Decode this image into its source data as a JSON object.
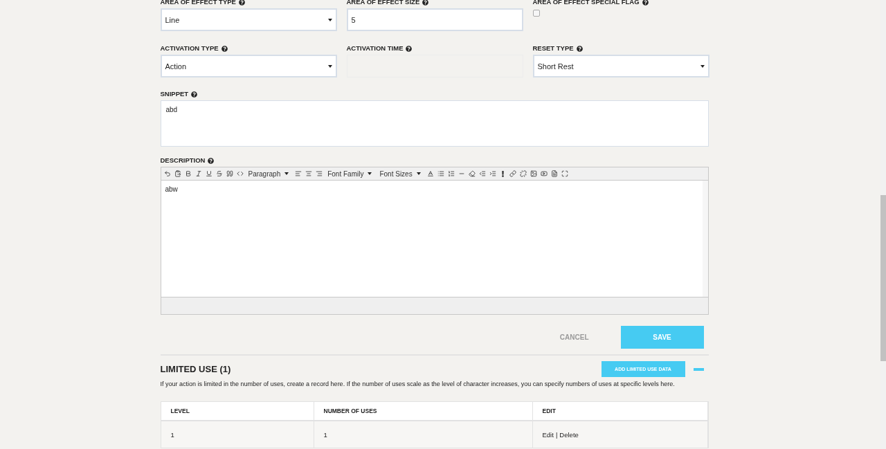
{
  "fields_row_1": [
    {
      "kind": "select",
      "label": "AREA OF EFFECT TYPE",
      "value": "Line"
    },
    {
      "kind": "text",
      "label": "AREA OF EFFECT SIZE",
      "value": "5"
    },
    {
      "kind": "checkbox",
      "label": "AREA OF EFFECT SPECIAL FLAG",
      "checked": false
    }
  ],
  "fields_row_2": [
    {
      "kind": "select",
      "label": "ACTIVATION TYPE",
      "value": "Action"
    },
    {
      "kind": "text",
      "label": "ACTIVATION TIME",
      "disabled": true
    },
    {
      "kind": "select",
      "label": "RESET TYPE",
      "value": "Short Rest"
    }
  ],
  "snippet": {
    "label": "SNIPPET",
    "value": "abd"
  },
  "description": {
    "label": "DESCRIPTION",
    "toolbar_dropdowns": [
      "Paragraph",
      "Font Family",
      "Font Sizes"
    ],
    "value": "abw"
  },
  "actions": {
    "cancel": "CANCEL",
    "save": "SAVE"
  },
  "limited_use": {
    "title": "LIMITED USE (1)",
    "add_button": "ADD LIMITED USE DATA",
    "expanded": true,
    "help": "If your action is limited in the number of uses, create a record here. If the number of uses scale as the level of character increases, you can specify numbers of uses at specific levels here.",
    "table": {
      "columns": [
        "LEVEL",
        "NUMBER OF USES",
        "EDIT"
      ],
      "rows": [
        {
          "level": "1",
          "uses": "1",
          "edit_link": "Edit",
          "delete_link": "Delete",
          "separator": "|"
        }
      ]
    }
  }
}
